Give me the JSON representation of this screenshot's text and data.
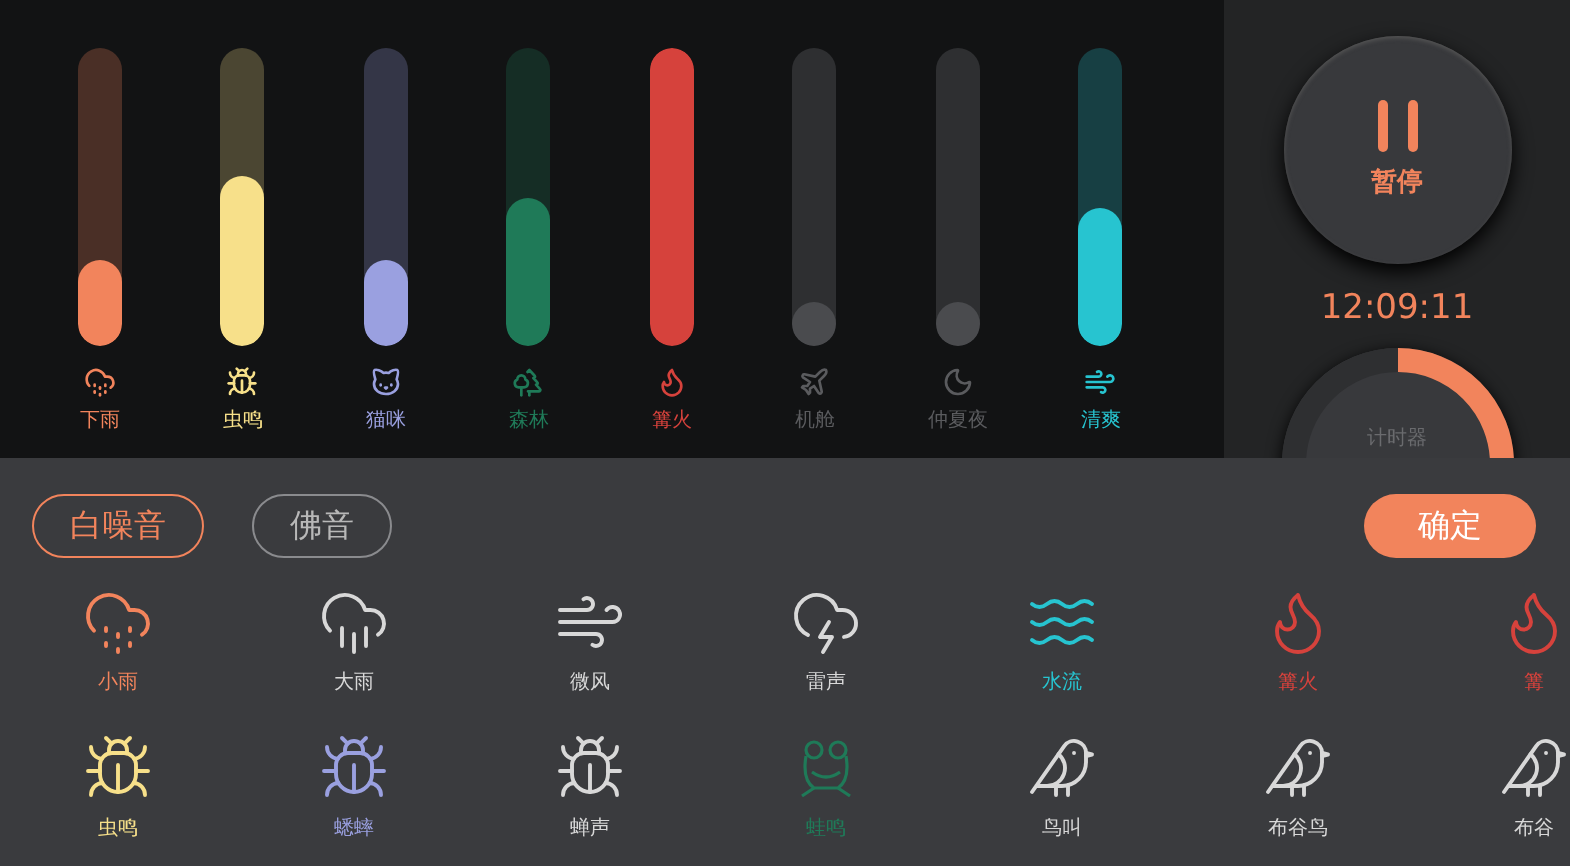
{
  "mixer": [
    {
      "label": "下雨",
      "color": "#f2845c",
      "level": 0.29,
      "on": true
    },
    {
      "label": "虫鸣",
      "color": "#f7e08a",
      "level": 0.57,
      "on": true
    },
    {
      "label": "猫咪",
      "color": "#9aa0e0",
      "level": 0.29,
      "on": true
    },
    {
      "label": "森林",
      "color": "#1f7a58",
      "level": 0.5,
      "on": true
    },
    {
      "label": "篝火",
      "color": "#d6423c",
      "level": 1,
      "on": true
    },
    {
      "label": "机舱",
      "color": "#4a4b4e",
      "level": 0,
      "on": false
    },
    {
      "label": "仲夏夜",
      "color": "#4a4b4e",
      "level": 0,
      "on": false
    },
    {
      "label": "清爽",
      "color": "#27c4d0",
      "level": 0.46,
      "on": true
    }
  ],
  "player": {
    "pause_label": "暂停",
    "time": "12:09:11",
    "timer_label": "计时器"
  },
  "tabs": [
    {
      "label": "白噪音",
      "selected": true
    },
    {
      "label": "佛音",
      "selected": false
    }
  ],
  "confirm": "确定",
  "sounds": [
    {
      "label": "小雨",
      "color": "#f2845c"
    },
    {
      "label": "大雨",
      "color": "#d8d8d8"
    },
    {
      "label": "微风",
      "color": "#d8d8d8"
    },
    {
      "label": "雷声",
      "color": "#d8d8d8"
    },
    {
      "label": "水流",
      "color": "#27c4d0"
    },
    {
      "label": "篝火",
      "color": "#d6423c"
    },
    {
      "label": "篝",
      "color": "#d6423c"
    },
    {
      "label": "虫鸣",
      "color": "#f7e08a"
    },
    {
      "label": "蟋蟀",
      "color": "#9aa0e0"
    },
    {
      "label": "蝉声",
      "color": "#d8d8d8"
    },
    {
      "label": "蛙鸣",
      "color": "#1f7a58"
    },
    {
      "label": "鸟叫",
      "color": "#d8d8d8"
    },
    {
      "label": "布谷鸟",
      "color": "#d8d8d8"
    },
    {
      "label": "布谷",
      "color": "#d8d8d8"
    }
  ]
}
